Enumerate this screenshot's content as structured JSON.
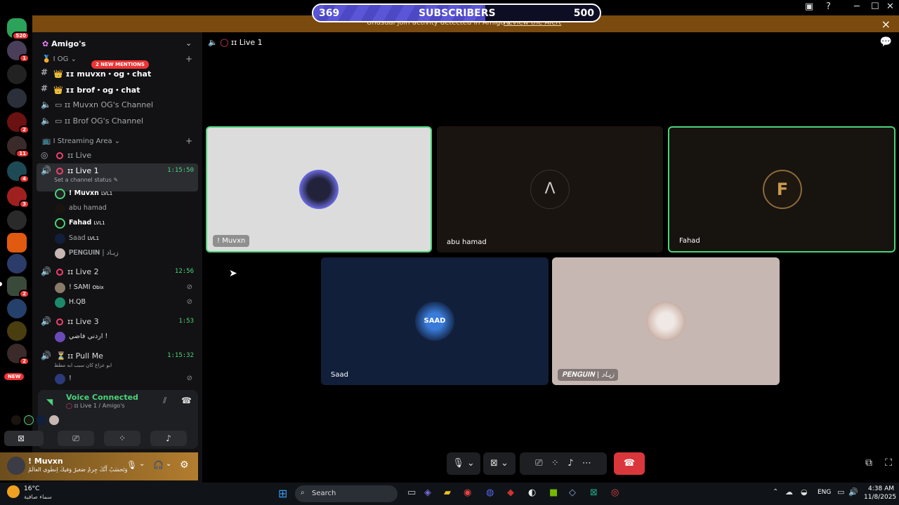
{
  "subscribers": {
    "current": "369",
    "label": "SUBSCRIBERS",
    "goal": "500",
    "progress_fraction": 0.6
  },
  "banner": {
    "message": "Unusual join activity detected in Amigo's",
    "action": "Review the Alert"
  },
  "rail": {
    "badges": [
      "520",
      "1",
      "2",
      "11",
      "4",
      "3",
      "2",
      "2"
    ],
    "new_label": "NEW"
  },
  "server": {
    "name": "Amigo's",
    "mentions": "2 NEW MENTIONS",
    "categories": {
      "og": "OG",
      "streaming": "Streaming Area"
    },
    "text_channels": [
      {
        "name": "muvxn・og・chat"
      },
      {
        "name": "brof・og・chat"
      }
    ],
    "og_voice": [
      {
        "name": "Muvxn OG's Channel"
      },
      {
        "name": "Brof OG's Channel"
      }
    ],
    "live": {
      "name": "Live"
    },
    "live1": {
      "name": "Live 1",
      "time": "1:15:50",
      "status": "Set a channel status",
      "members": [
        {
          "name": "! Muvxn",
          "tag": "LVL1"
        },
        {
          "name": "abu hamad",
          "tag": ""
        },
        {
          "name": "Fahad",
          "tag": "LVL1"
        },
        {
          "name": "Saad",
          "tag": "LVL1"
        },
        {
          "name": "𝐏𝐄𝐍𝐆𝐔𝐈𝐍 | زيـاد",
          "tag": ""
        }
      ]
    },
    "live2": {
      "name": "Live 2",
      "time": "12:56",
      "members": [
        {
          "name": "! SAMI",
          "tag": "Obix"
        },
        {
          "name": "H.QB",
          "tag": ""
        }
      ]
    },
    "live3": {
      "name": "Live 3",
      "time": "1:53",
      "members": [
        {
          "name": "اردني فاضي !"
        }
      ]
    },
    "pullme": {
      "name": "Pull Me",
      "time": "1:15:32",
      "status": "ابو عزاع كان سبب ابه مطط",
      "members": [
        {
          "name": "!"
        }
      ]
    }
  },
  "voice": {
    "title": "Voice Connected",
    "subtitle": "Live 1 / Amigo's"
  },
  "user": {
    "name": "! Muvxn",
    "status": "وَتَحسَبُ أَنَّكَ جِرمٌ صَغيرٌ وَفيكَ اِنطَوى العالَمُ"
  },
  "main": {
    "channel_title": "Live 1",
    "tiles": [
      {
        "name": "! Muvxn",
        "bg": "#dcdcdc",
        "highlight": true
      },
      {
        "name": "abu hamad",
        "bg": "#1a1410",
        "highlight": false
      },
      {
        "name": "Fahad",
        "bg": "#17130f",
        "highlight": true
      },
      {
        "name": "Saad",
        "bg": "#111f3a",
        "highlight": false
      },
      {
        "name": "𝐏𝐄𝐍𝐆𝐔𝐈𝐍 | زيـاد",
        "bg": "#c7b7b3",
        "highlight": false
      }
    ]
  },
  "taskbar": {
    "weather_temp": "16°C",
    "weather_desc": "سماء صافية",
    "search": "Search",
    "lang": "ENG",
    "time": "4:38 AM",
    "date": "11/8/2025"
  },
  "colors": {
    "accent_green": "#4cd37a",
    "live_red": "#f23f6d",
    "end_call": "#da373c",
    "progress": "#5b56d8"
  }
}
